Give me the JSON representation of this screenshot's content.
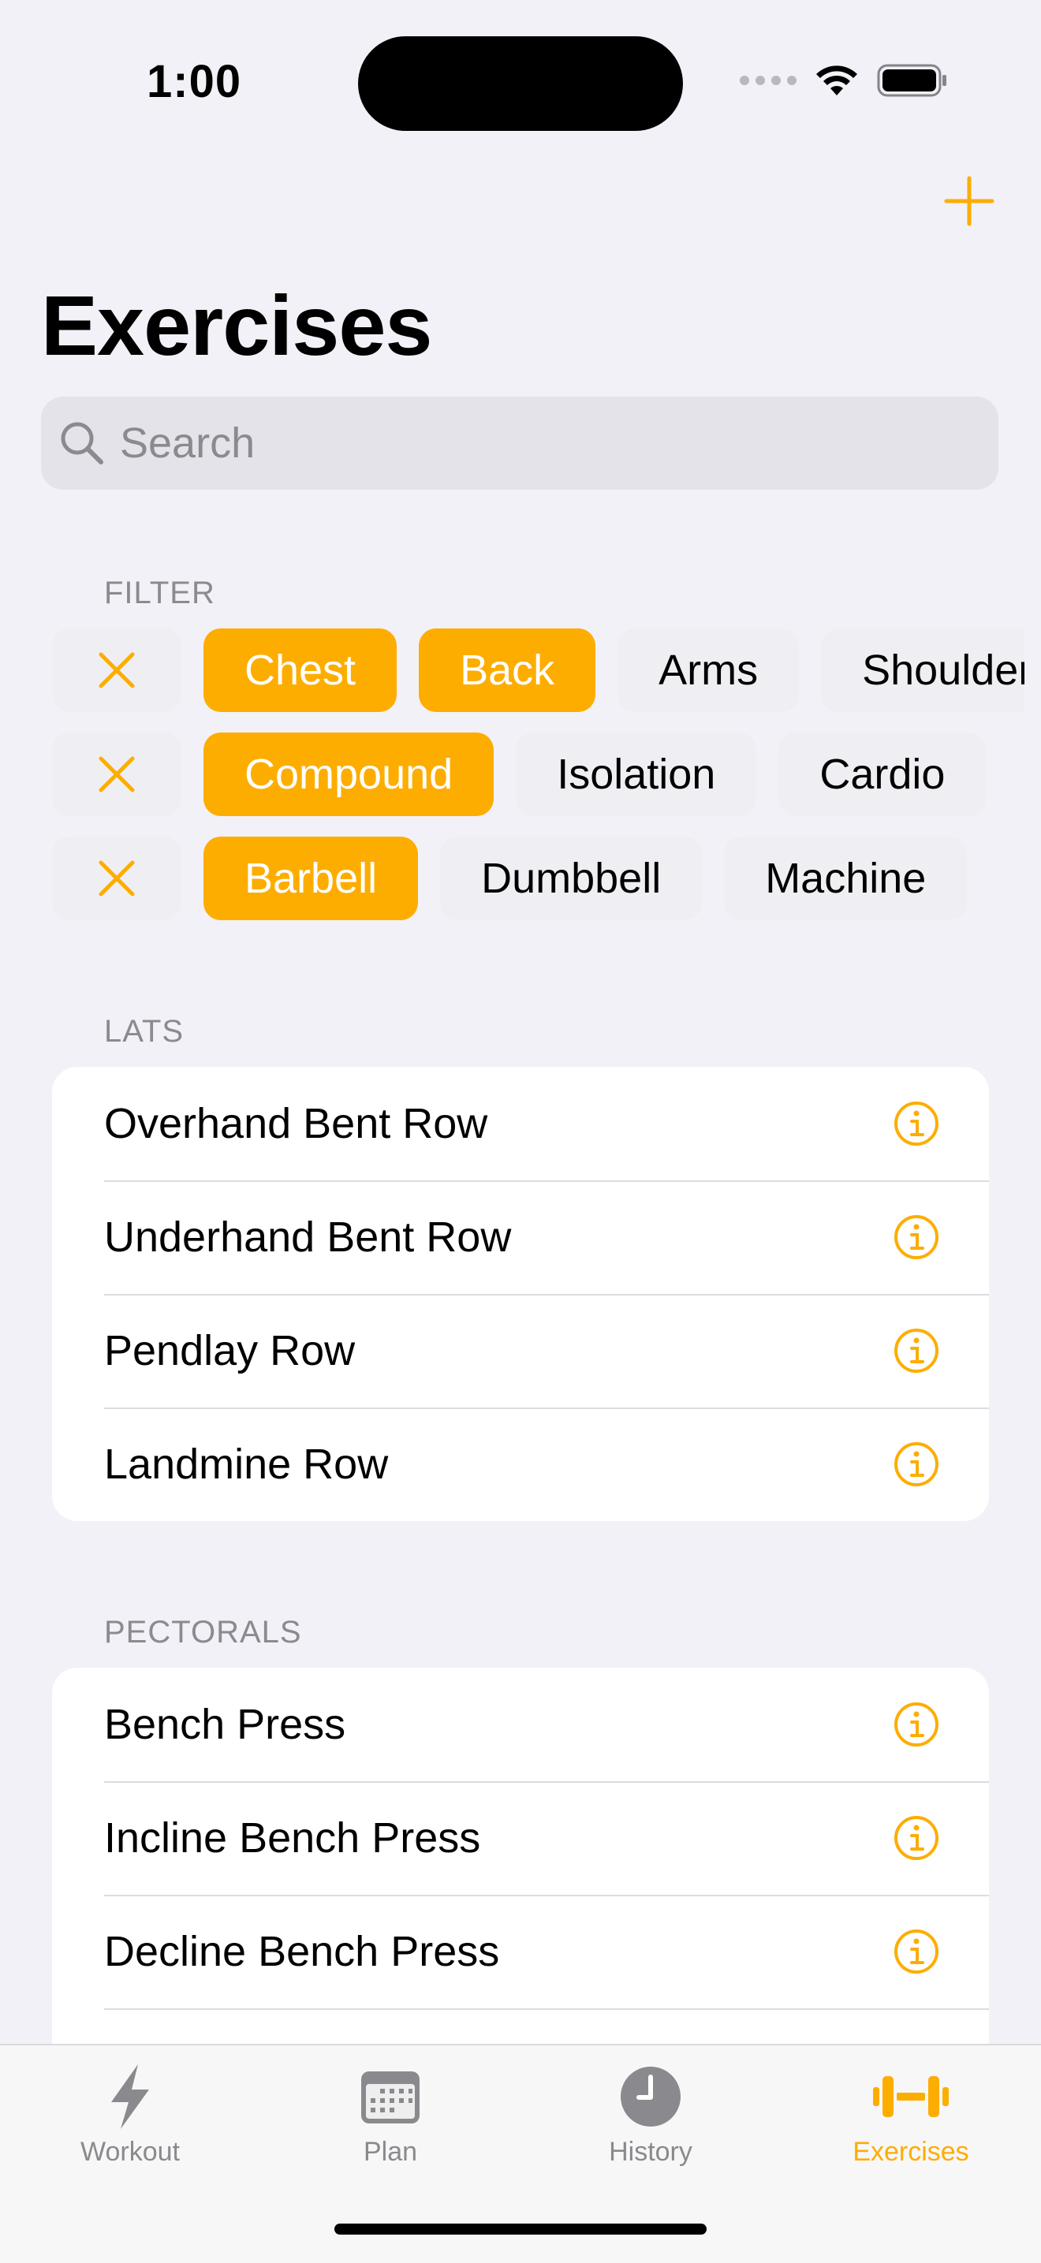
{
  "status_bar": {
    "time": "1:00"
  },
  "header": {
    "title": "Exercises"
  },
  "search": {
    "placeholder": "Search"
  },
  "filter": {
    "header": "FILTER",
    "rows": [
      {
        "chips": [
          {
            "label": "Chest",
            "selected": true
          },
          {
            "label": "Back",
            "selected": true
          },
          {
            "label": "Arms",
            "selected": false
          },
          {
            "label": "Shoulders",
            "selected": false
          }
        ]
      },
      {
        "chips": [
          {
            "label": "Compound",
            "selected": true
          },
          {
            "label": "Isolation",
            "selected": false
          },
          {
            "label": "Cardio",
            "selected": false
          }
        ]
      },
      {
        "chips": [
          {
            "label": "Barbell",
            "selected": true
          },
          {
            "label": "Dumbbell",
            "selected": false
          },
          {
            "label": "Machine",
            "selected": false
          }
        ]
      }
    ]
  },
  "sections": [
    {
      "header": "LATS",
      "items": [
        "Overhand Bent Row",
        "Underhand Bent Row",
        "Pendlay Row",
        "Landmine Row"
      ]
    },
    {
      "header": "PECTORALS",
      "items": [
        "Bench Press",
        "Incline Bench Press",
        "Decline Bench Press"
      ]
    }
  ],
  "tabbar": {
    "tabs": [
      {
        "label": "Workout",
        "icon": "bolt-icon",
        "active": false
      },
      {
        "label": "Plan",
        "icon": "calendar-icon",
        "active": false
      },
      {
        "label": "History",
        "icon": "clock-icon",
        "active": false
      },
      {
        "label": "Exercises",
        "icon": "dumbbell-icon",
        "active": true
      }
    ]
  },
  "colors": {
    "accent": "#fdad00",
    "background": "#f2f1f7",
    "inactive": "#8a8a8e"
  }
}
